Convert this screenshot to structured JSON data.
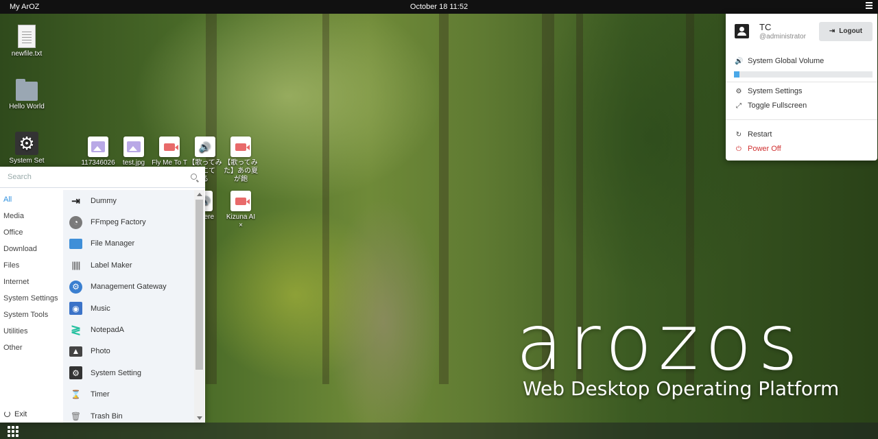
{
  "topbar": {
    "title": "My ArOZ",
    "clock": "October 18 11:52",
    "menu_icon": "hamburger-icon"
  },
  "desktop": {
    "files": [
      {
        "label": "newfile.txt",
        "icon": "text-file-icon"
      },
      {
        "label": "Hello World",
        "icon": "folder-icon"
      },
      {
        "label": "System Set",
        "icon": "gear-icon"
      },
      {
        "label": "117346026",
        "icon": "image-icon"
      },
      {
        "label": "test.jpg",
        "icon": "image-icon"
      },
      {
        "label": "Fly Me To T",
        "icon": "video-icon"
      },
      {
        "label": "【歌ってみ\nたにて\nる",
        "icon": "audio-icon"
      },
      {
        "label": "【歌ってみ\nた】あの夏\nが飽",
        "icon": "video-icon"
      },
      {
        "label": "There",
        "icon": "audio-icon"
      },
      {
        "label": "Kizuna AI\n×",
        "icon": "video-icon"
      }
    ]
  },
  "start_menu": {
    "search_placeholder": "Search",
    "categories": [
      "All",
      "Media",
      "Office",
      "Download",
      "Files",
      "Internet",
      "System Settings",
      "System Tools",
      "Utilities",
      "Other"
    ],
    "active_category": "All",
    "exit_label": "Exit",
    "apps": [
      {
        "label": "Dummy",
        "icon": "login-arrow-icon",
        "color": "#222222"
      },
      {
        "label": "FFmpeg Factory",
        "icon": "ffmpeg-icon",
        "color": "#666666"
      },
      {
        "label": "File Manager",
        "icon": "folder-icon",
        "color": "#3f8fd8"
      },
      {
        "label": "Label Maker",
        "icon": "barcode-icon",
        "color": "#555555"
      },
      {
        "label": "Management Gateway",
        "icon": "gateway-icon",
        "color": "#3a7fd0"
      },
      {
        "label": "Music",
        "icon": "music-disc-icon",
        "color": "#3b73c8"
      },
      {
        "label": "NotepadA",
        "icon": "notepad-icon",
        "color": "#26c0a0"
      },
      {
        "label": "Photo",
        "icon": "photo-icon",
        "color": "#444444"
      },
      {
        "label": "System Setting",
        "icon": "gear-icon",
        "color": "#333333"
      },
      {
        "label": "Timer",
        "icon": "hourglass-icon",
        "color": "#777777"
      },
      {
        "label": "Trash Bin",
        "icon": "trash-icon",
        "color": "#888888"
      }
    ]
  },
  "user_panel": {
    "name": "TC",
    "handle": "@administrator",
    "logout_label": "Logout",
    "volume_label": "System Global Volume",
    "volume_fraction": 0.04,
    "settings_label": "System Settings",
    "fullscreen_label": "Toggle Fullscreen",
    "restart_label": "Restart",
    "poweroff_label": "Power Off"
  },
  "branding": {
    "title": "arozos",
    "subtitle": "Web Desktop Operating Platform"
  }
}
